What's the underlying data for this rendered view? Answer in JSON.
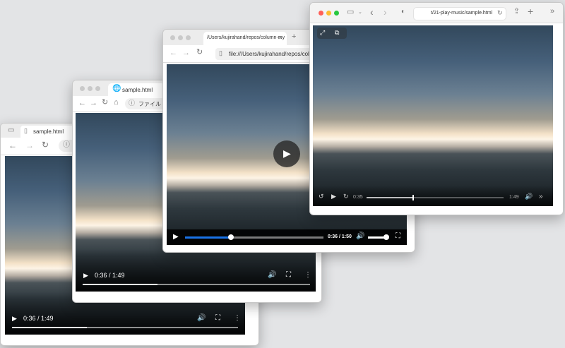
{
  "win1": {
    "tab_title": "sample.html",
    "time": "0:36 / 1:49",
    "progress": 0.33
  },
  "win2": {
    "tab_title": "sample.html",
    "address": "ファイル",
    "time": "0:36 / 1:49",
    "progress": 0.33
  },
  "win3": {
    "tab_title": "/Users/kujirahand/repos/column-my",
    "address": "file:///Users/kujirahand/repos/colu",
    "current": "0:36",
    "duration": "1:50",
    "progress": 0.33,
    "volume": 0.85,
    "accent": "#1a73e8"
  },
  "win4": {
    "address": "t/21-play-music/sample.html",
    "current": "0:35",
    "remaining": "1:49",
    "progress": 0.34
  }
}
